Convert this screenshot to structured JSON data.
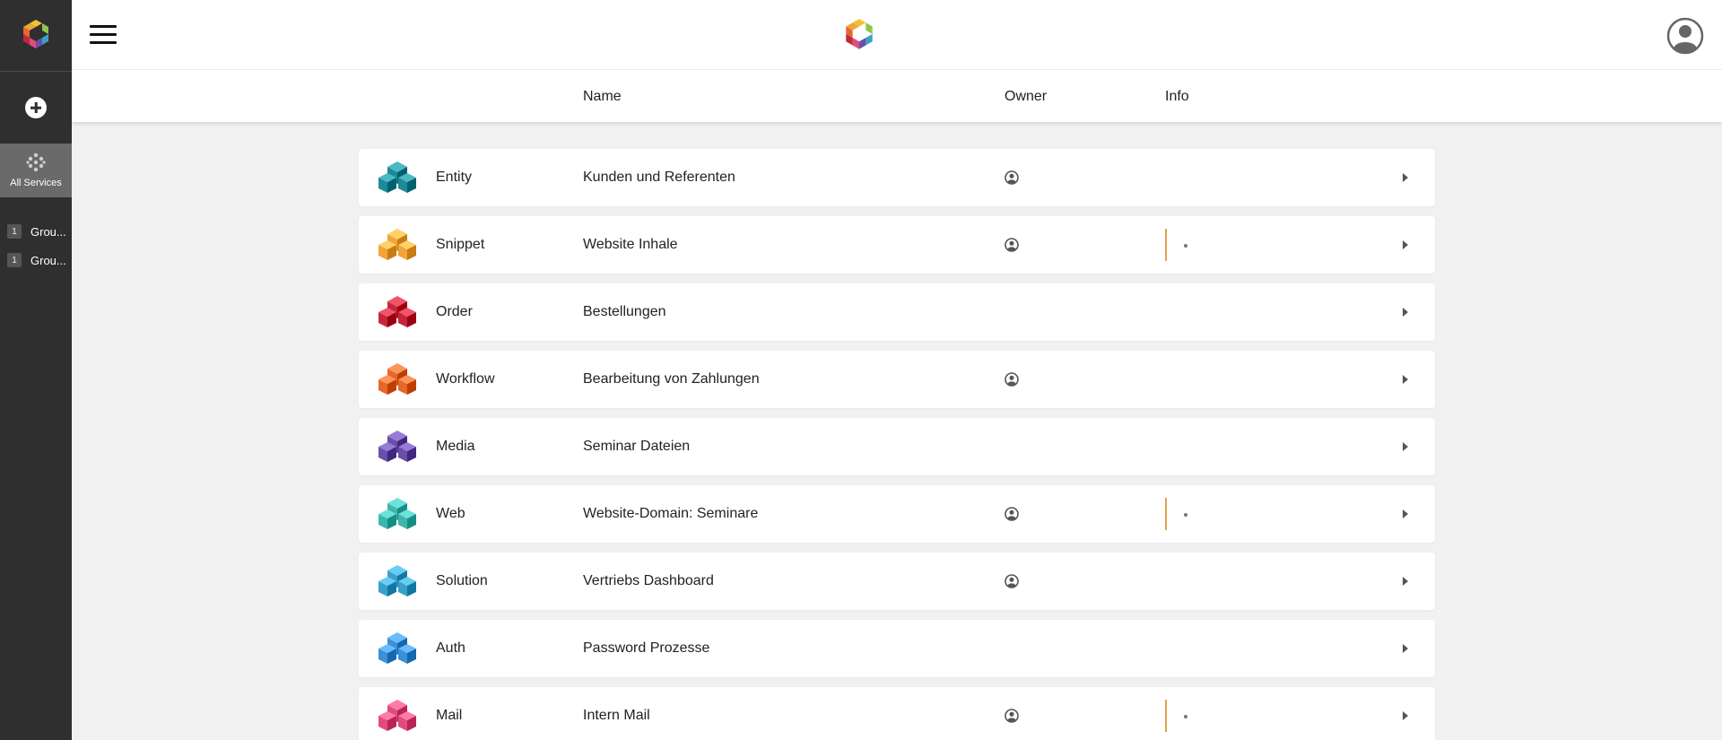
{
  "sidebar": {
    "all_services_label": "All Services",
    "groups": [
      {
        "badge": "1",
        "label": "Grou..."
      },
      {
        "badge": "1",
        "label": "Grou..."
      }
    ]
  },
  "header": {
    "columns": {
      "name": "Name",
      "owner": "Owner",
      "info": "Info"
    }
  },
  "services": [
    {
      "type": "Entity",
      "name": "Kunden und Referenten",
      "owner": true,
      "info": false,
      "color": "#1e8a96"
    },
    {
      "type": "Snippet",
      "name": "Website Inhale",
      "owner": true,
      "info": true,
      "color": "#f0a43a"
    },
    {
      "type": "Order",
      "name": "Bestellungen",
      "owner": false,
      "info": false,
      "color": "#c4273b"
    },
    {
      "type": "Workflow",
      "name": "Bearbeitung von Zahlungen",
      "owner": true,
      "info": false,
      "color": "#e6672b"
    },
    {
      "type": "Media",
      "name": "Seminar Dateien",
      "owner": false,
      "info": false,
      "color": "#6a4fa8"
    },
    {
      "type": "Web",
      "name": "Website-Domain: Seminare",
      "owner": true,
      "info": true,
      "color": "#3fb6ad"
    },
    {
      "type": "Solution",
      "name": "Vertriebs Dashboard",
      "owner": true,
      "info": false,
      "color": "#3aa0c9"
    },
    {
      "type": "Auth",
      "name": "Password Prozesse",
      "owner": false,
      "info": false,
      "color": "#3d8fd6"
    },
    {
      "type": "Mail",
      "name": "Intern Mail",
      "owner": true,
      "info": true,
      "color": "#e04d7c"
    }
  ],
  "icons": {
    "menu": "hamburger-menu-icon",
    "add": "plus-circle-icon",
    "all_services": "dots-grid-icon",
    "owner": "user-circle-icon",
    "row": "cube-icon",
    "chevron": "chevron-right-icon",
    "profile": "account-avatar-icon",
    "logo": "brand-logo-icon"
  }
}
